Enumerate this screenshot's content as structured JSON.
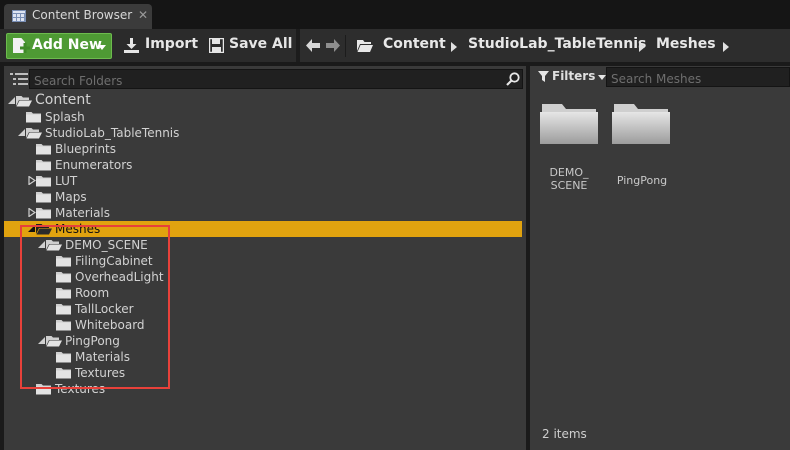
{
  "tab": {
    "title": "Content Browser",
    "close": "✕"
  },
  "toolbar": {
    "add_new": "Add New",
    "import": "Import",
    "save_all": "Save All"
  },
  "breadcrumb": [
    "Content",
    "StudioLab_TableTennis",
    "Meshes"
  ],
  "left_panel": {
    "search_placeholder": "Search Folders",
    "tree": [
      {
        "label": "Content",
        "depth": 0,
        "arrow": "expanded",
        "open": true,
        "root": true
      },
      {
        "label": "Splash",
        "depth": 1,
        "arrow": "none"
      },
      {
        "label": "StudioLab_TableTennis",
        "depth": 1,
        "arrow": "expanded",
        "open": true
      },
      {
        "label": "Blueprints",
        "depth": 2,
        "arrow": "none"
      },
      {
        "label": "Enumerators",
        "depth": 2,
        "arrow": "none"
      },
      {
        "label": "LUT",
        "depth": 2,
        "arrow": "collapsed"
      },
      {
        "label": "Maps",
        "depth": 2,
        "arrow": "none"
      },
      {
        "label": "Materials",
        "depth": 2,
        "arrow": "collapsed"
      },
      {
        "label": "Meshes",
        "depth": 2,
        "arrow": "expanded",
        "open": true,
        "selected": true
      },
      {
        "label": "DEMO_SCENE",
        "depth": 3,
        "arrow": "expanded",
        "open": true
      },
      {
        "label": "FilingCabinet",
        "depth": 4,
        "arrow": "none"
      },
      {
        "label": "OverheadLight",
        "depth": 4,
        "arrow": "none"
      },
      {
        "label": "Room",
        "depth": 4,
        "arrow": "none"
      },
      {
        "label": "TallLocker",
        "depth": 4,
        "arrow": "none"
      },
      {
        "label": "Whiteboard",
        "depth": 4,
        "arrow": "none"
      },
      {
        "label": "PingPong",
        "depth": 3,
        "arrow": "expanded",
        "open": true
      },
      {
        "label": "Materials",
        "depth": 4,
        "arrow": "none"
      },
      {
        "label": "Textures",
        "depth": 4,
        "arrow": "none"
      },
      {
        "label": "Textures",
        "depth": 2,
        "arrow": "none"
      }
    ]
  },
  "right_panel": {
    "filters_label": "Filters",
    "search_placeholder": "Search Meshes",
    "assets": [
      {
        "label": "DEMO_ SCENE"
      },
      {
        "label": "PingPong"
      }
    ],
    "item_count": "2 items"
  },
  "colors": {
    "selection": "#e1a30f",
    "add_new": "#4e9a34",
    "highlight_box": "#e8413a",
    "panel": "#3a3a3a"
  },
  "icons": [
    "content-browser-icon",
    "new-file-icon",
    "import-icon",
    "save-icon",
    "back-arrow-icon",
    "forward-arrow-icon",
    "folder-icon",
    "search-icon",
    "filter-icon",
    "tree-view-icon"
  ]
}
